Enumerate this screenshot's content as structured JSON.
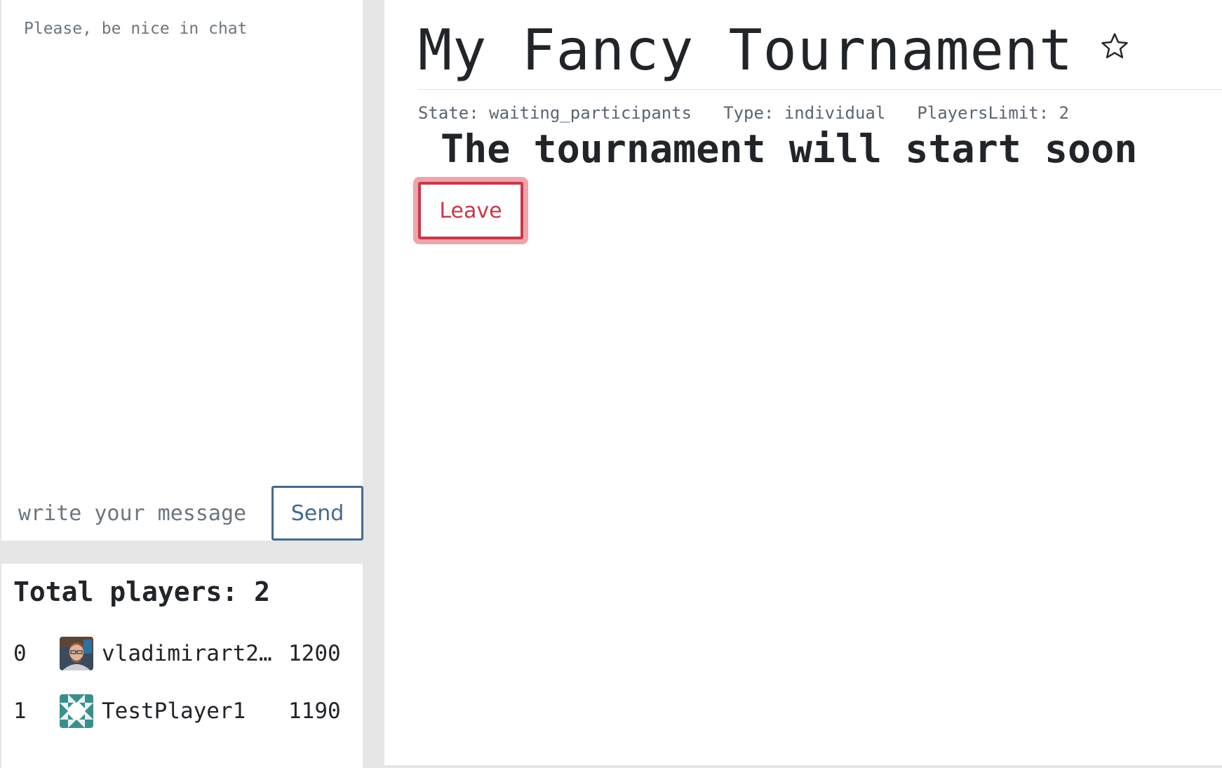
{
  "chat": {
    "notice": "Please, be nice in chat",
    "input_placeholder": "write your message",
    "send_label": "Send"
  },
  "players": {
    "total_label": "Total players: 2",
    "list": [
      {
        "rank": "0",
        "name": "vladimirart2…",
        "rating": "1200",
        "avatar": "user-photo-avatar"
      },
      {
        "rank": "1",
        "name": "TestPlayer1",
        "rating": "1190",
        "avatar": "identicon-avatar"
      }
    ]
  },
  "tournament": {
    "title": "My Fancy Tournament",
    "star_icon": "star-outline-icon",
    "state": "State: waiting_participants",
    "type": "Type: individual",
    "players_limit": "PlayersLimit: 2",
    "start_message": "The tournament will start soon",
    "leave_label": "Leave"
  },
  "colors": {
    "send_border": "#456a8c",
    "leave_red": "#c8384a",
    "identicon": "#3a8f8c",
    "background": "#e6e6e6"
  }
}
